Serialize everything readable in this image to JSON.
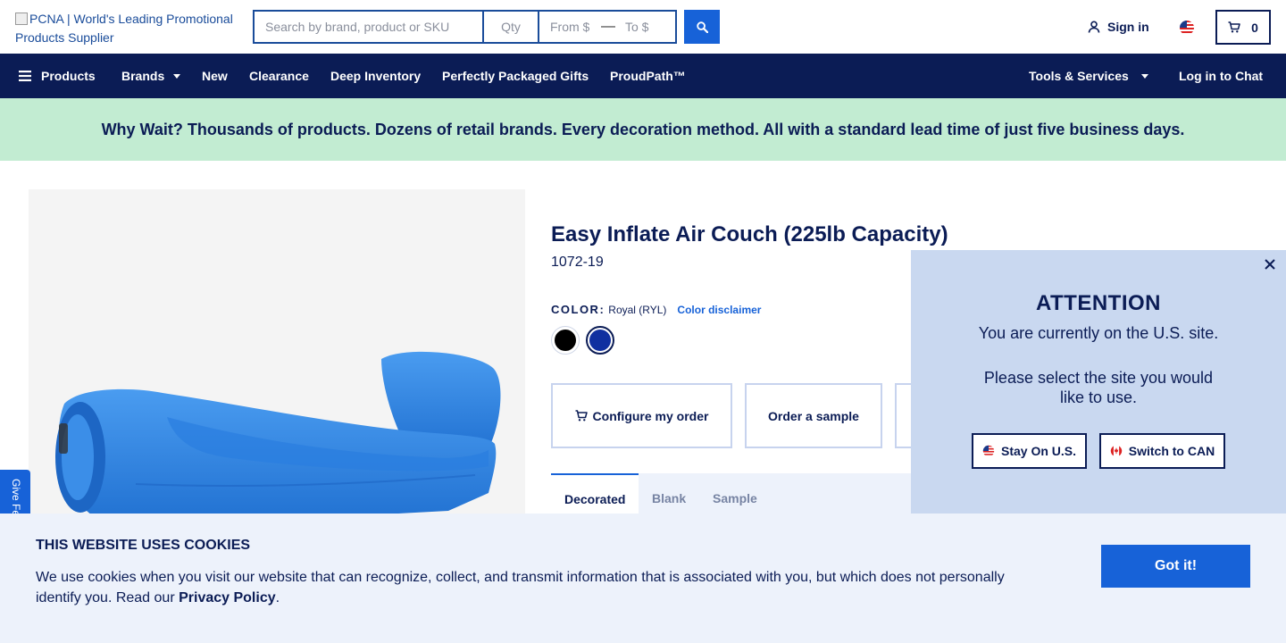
{
  "header": {
    "logo_alt": "PCNA | World's Leading Promotional Products Supplier",
    "search_placeholder": "Search by brand, product or SKU",
    "qty_placeholder": "Qty",
    "from_placeholder": "From $",
    "range_separator": "—",
    "to_placeholder": "To $",
    "signin_label": "Sign in",
    "cart_count": "0"
  },
  "nav": {
    "products": "Products",
    "brands": "Brands",
    "new": "New",
    "clearance": "Clearance",
    "deep_inventory": "Deep Inventory",
    "packaged_gifts": "Perfectly Packaged Gifts",
    "proudpath": "ProudPath™",
    "tools": "Tools & Services",
    "chat": "Log in to Chat"
  },
  "promo": "Why Wait? Thousands of products. Dozens of retail brands. Every decoration method. All with a standard lead time of just five business days.",
  "product": {
    "title": "Easy Inflate Air Couch (225lb Capacity)",
    "sku": "1072-19",
    "color_label": "COLOR:",
    "color_value": "Royal (RYL)",
    "color_disclaimer": "Color disclaimer",
    "swatches": [
      {
        "name": "Black",
        "hex": "#000000"
      },
      {
        "name": "Royal",
        "hex": "#1030a0"
      }
    ],
    "image_color": "#2f86e0"
  },
  "actions": {
    "configure": "Configure my order",
    "sample": "Order a sample"
  },
  "tabs": [
    "Decorated",
    "Blank",
    "Sample"
  ],
  "attention": {
    "title": "ATTENTION",
    "message1": "You are currently on the U.S. site.",
    "message2": "Please select the site you would like to use.",
    "stay_label": "Stay On U.S.",
    "switch_label": "Switch to CAN"
  },
  "feedback_label": "Give Feedback",
  "cookie": {
    "title": "THIS WEBSITE USES COOKIES",
    "text_before": "We use cookies when you visit our website that can recognize, collect, and transmit information that is associated with you, but which does not personally identify you. Read our ",
    "link": "Privacy Policy",
    "text_after": ".",
    "button": "Got it!"
  },
  "colors": {
    "navy": "#0b1c55",
    "accent": "#1762d8",
    "promo_bg": "#c2ecd2",
    "popup_bg": "#c9d8f0",
    "cookie_bg": "#edf2fb"
  }
}
